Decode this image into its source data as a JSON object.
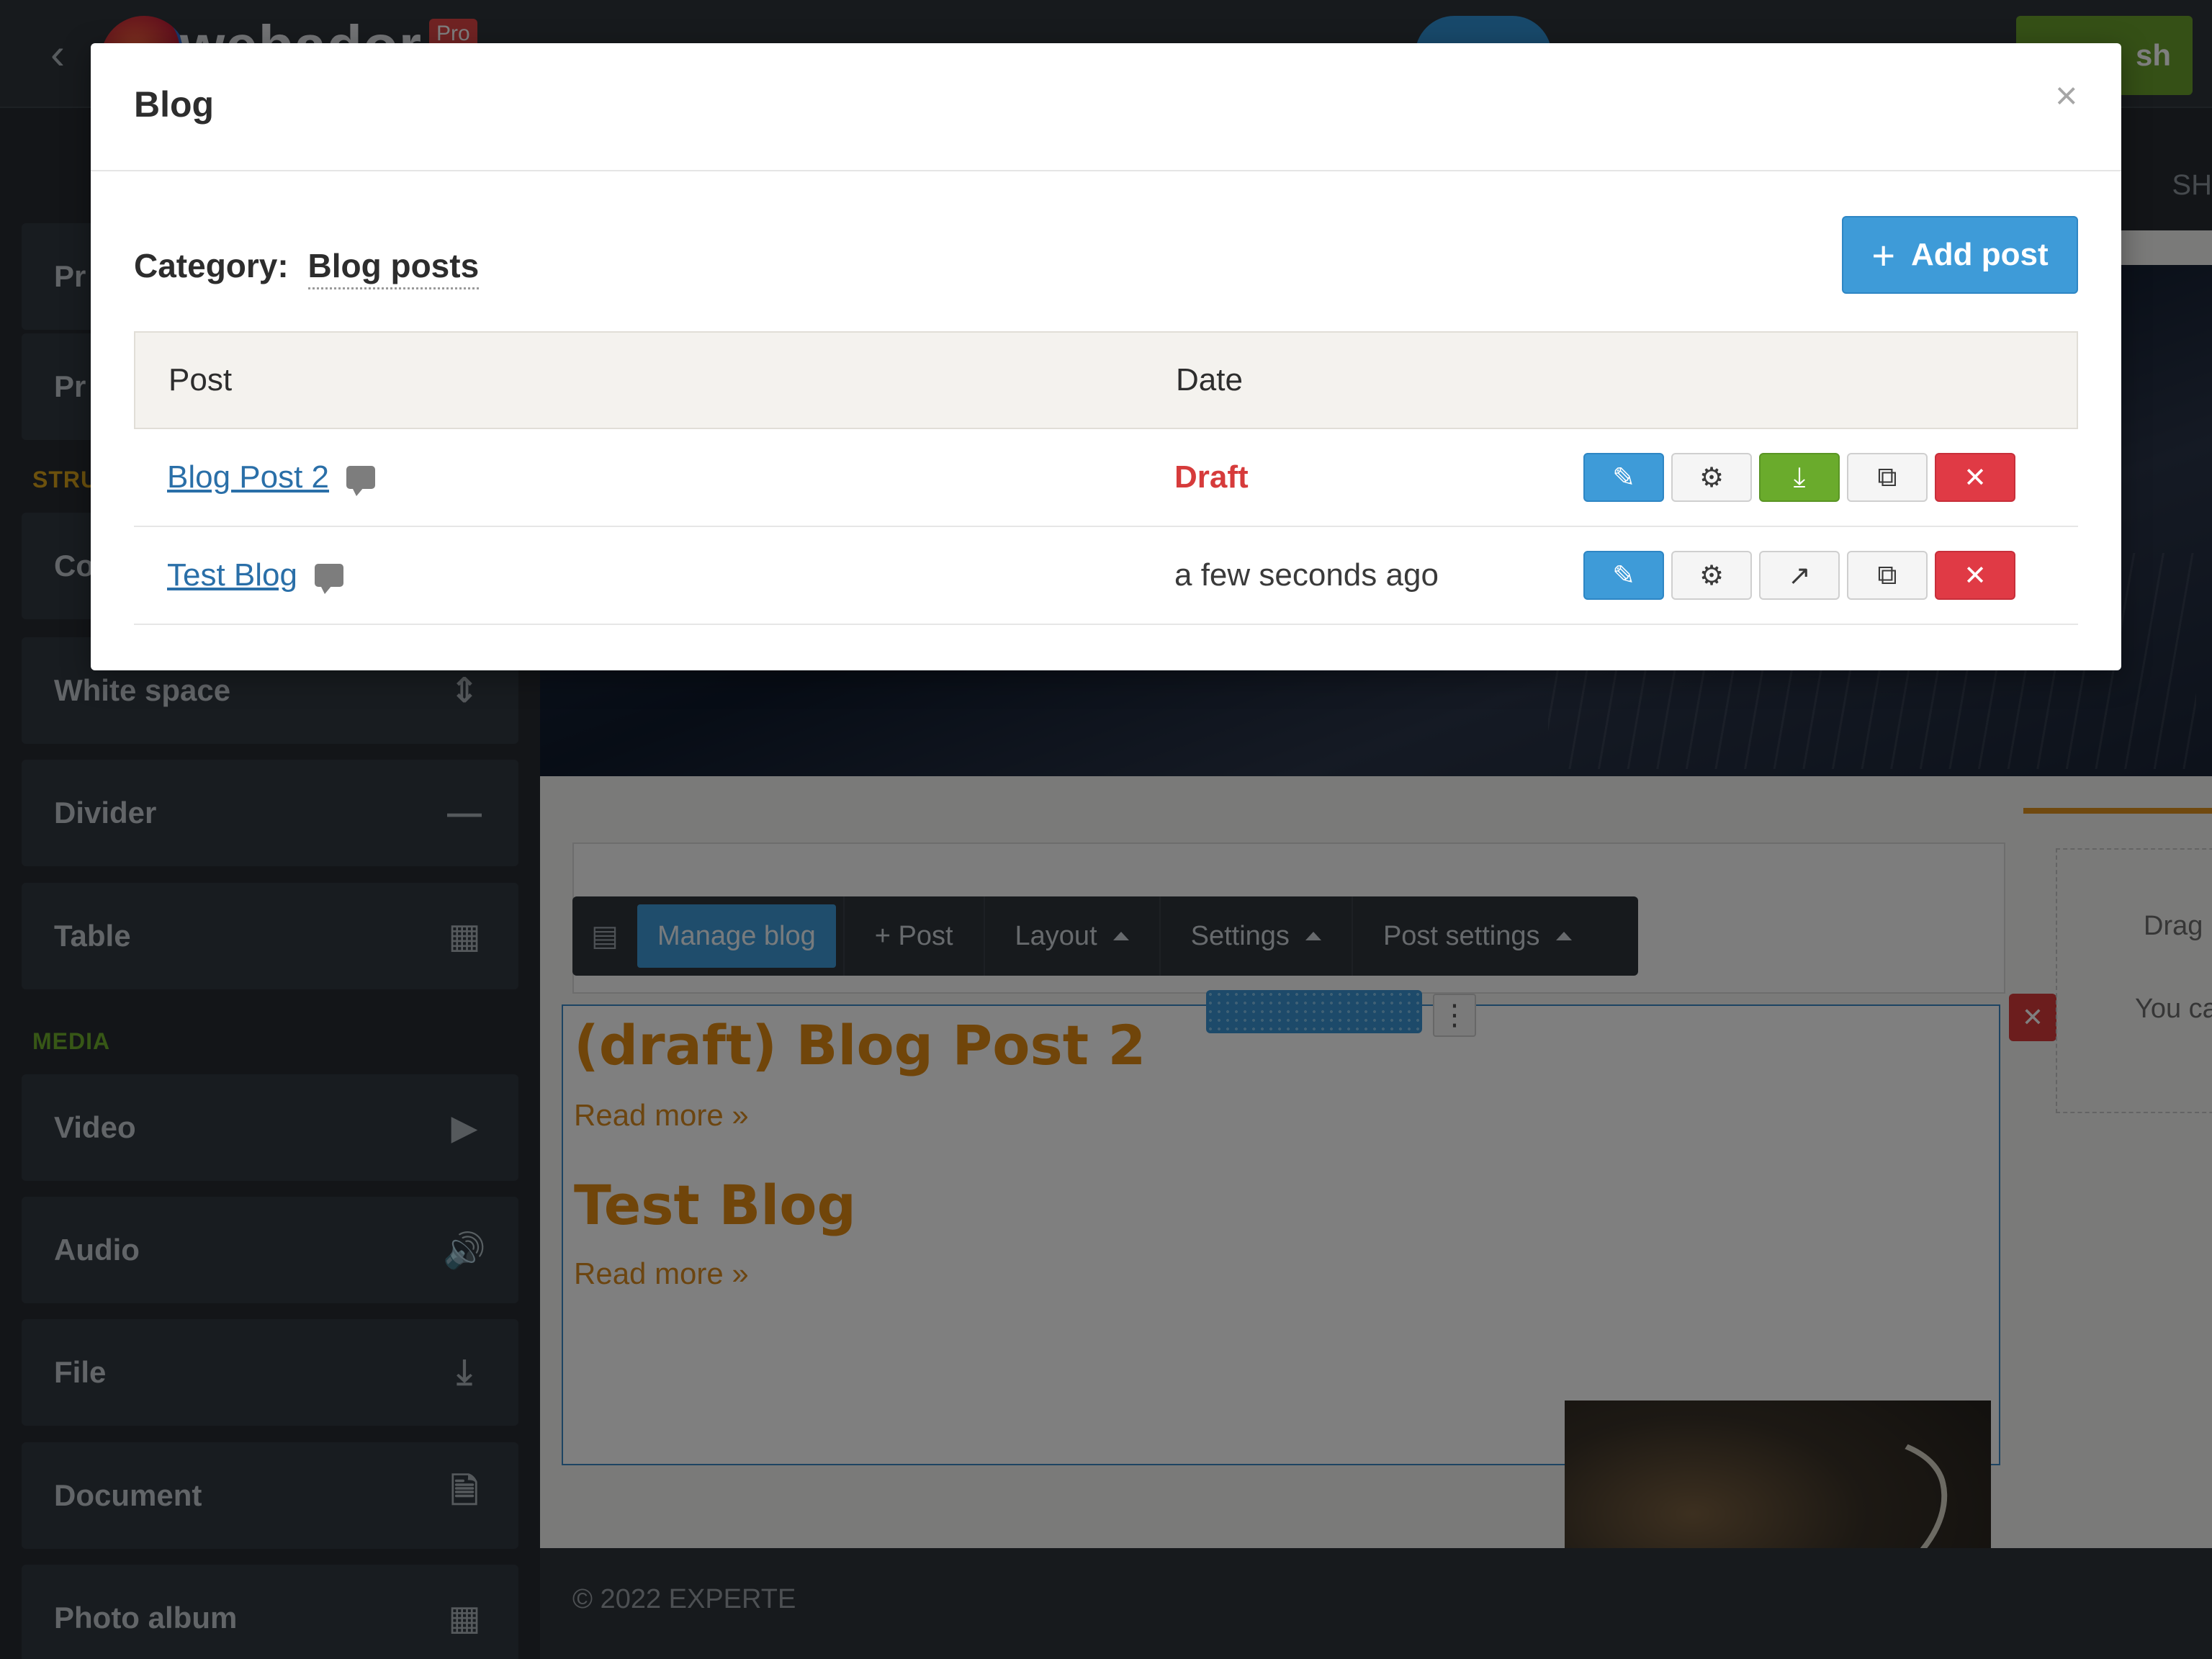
{
  "editor": {
    "brand": "webador",
    "pro_badge": "Pro",
    "publish_label": "sh",
    "subbar_tab": "SH",
    "sidebar": {
      "truncated_items": [
        "Pr",
        "Pr",
        "Co"
      ],
      "sections": [
        {
          "label": "STRU",
          "color": "#d9a21b"
        },
        {
          "label": "MEDIA",
          "color": "#6fae2c"
        }
      ],
      "items": [
        {
          "label": "White space",
          "icon": "whitespace-icon"
        },
        {
          "label": "Divider",
          "icon": "divider-icon"
        },
        {
          "label": "Table",
          "icon": "table-icon"
        },
        {
          "label": "Video",
          "icon": "video-icon"
        },
        {
          "label": "Audio",
          "icon": "audio-icon"
        },
        {
          "label": "File",
          "icon": "download-icon"
        },
        {
          "label": "Document",
          "icon": "document-icon"
        },
        {
          "label": "Photo album",
          "icon": "grid-icon"
        }
      ]
    },
    "blog_toolbar": {
      "manage": "Manage blog",
      "post": "+ Post",
      "layout": "Layout",
      "settings": "Settings",
      "post_settings": "Post settings"
    },
    "blog_posts": [
      {
        "title": "(draft) Blog Post 2",
        "read_more": "Read more »"
      },
      {
        "title": "Test Blog",
        "read_more": "Read more »"
      }
    ],
    "side_dropzone": {
      "line1": "Drag",
      "line2": "You ca"
    },
    "footer": "© 2022 EXPERTE"
  },
  "modal": {
    "title": "Blog",
    "close": "×",
    "category_label": "Category:",
    "category_value": "Blog posts",
    "add_post_label": "Add post",
    "columns": {
      "post": "Post",
      "date": "Date"
    },
    "rows": [
      {
        "post": "Blog Post 2",
        "date": "Draft",
        "status": "draft",
        "third_action": "publish"
      },
      {
        "post": "Test Blog",
        "date": "a few seconds ago",
        "status": "published",
        "third_action": "open-external"
      }
    ]
  },
  "colors": {
    "accent_blue": "#3e9bd8",
    "danger_red": "#e03a45",
    "success_green": "#6aab2c",
    "draft_text": "#d63b3b",
    "post_title_orange": "#e08a14"
  }
}
